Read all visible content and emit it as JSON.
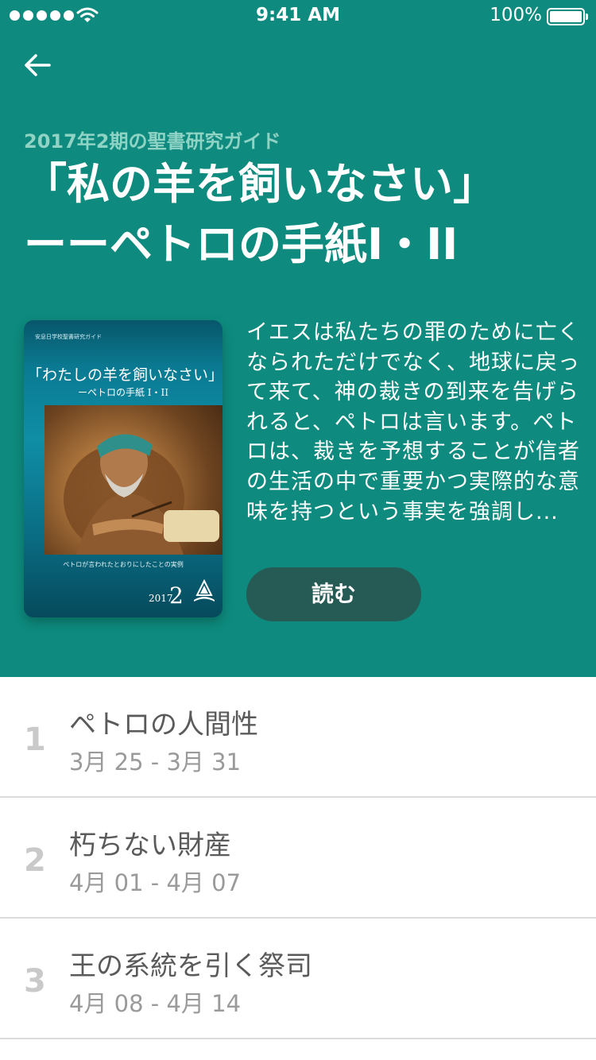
{
  "status_bar": {
    "time": "9:41 AM",
    "battery_percent": "100%",
    "battery_level": 1.0,
    "signal_icon": "signal-dots-icon",
    "wifi_icon": "wifi-icon"
  },
  "header": {
    "back_icon": "arrow-left-icon",
    "subtitle": "2017年2期の聖書研究ガイド",
    "title_line1": "「私の羊を飼いなさい」",
    "title_line2": "ーーペトロの手紙I・II"
  },
  "cover": {
    "top_text": "安息日学校聖書研究ガイド",
    "title": "「わたしの羊を飼いなさい」",
    "subtitle": "ーペトロの手紙 I・II",
    "caption": "ペトロが言われたとおりにしたことの実例",
    "year": "2017",
    "quarter": "2"
  },
  "description": "イエスは私たちの罪のために亡くなられただけでなく、地球に戻って来て、神の裁きの到来を告げられると、ペトロは言います。ペトロは、裁きを予想することが信者の生活の中で重要かつ実際的な意味を持つという事実を強調し...",
  "read_button": "読む",
  "lessons": [
    {
      "number": "1",
      "title": "ペトロの人間性",
      "dates": "3月 25 - 3月 31"
    },
    {
      "number": "2",
      "title": "朽ちない財産",
      "dates": "4月 01 - 4月 07"
    },
    {
      "number": "3",
      "title": "王の系統を引く祭司",
      "dates": "4月 08 - 4月 14"
    }
  ],
  "colors": {
    "hero_background": "#0e8b7e",
    "subtitle": "#8fd3c5",
    "button_background": "#265a55"
  }
}
